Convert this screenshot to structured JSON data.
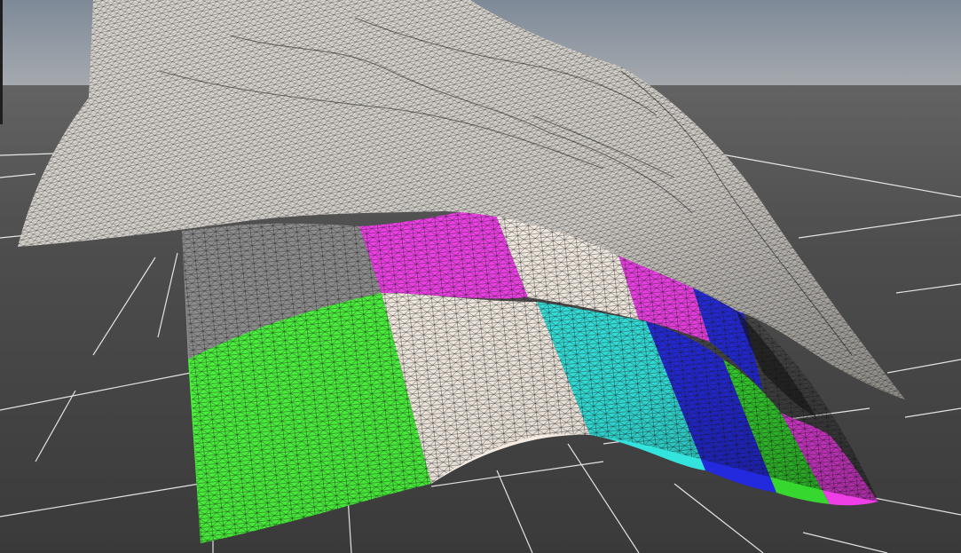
{
  "scene": {
    "colors": {
      "sky_top": "#7e8a98",
      "sky_horizon": "#a3a8ae",
      "ground_far": "#5b5b5b",
      "ground_near": "#3c3c3c",
      "grid_line": "#ffffff",
      "cloth_wire": "#efece6",
      "wire_stroke": "#1a1a1a",
      "patch_green": "#48f23a",
      "patch_cream": "#f4ece2",
      "patch_magenta": "#ee3ee6",
      "patch_cyan": "#33e3dd",
      "patch_blue": "#2329dc"
    }
  }
}
